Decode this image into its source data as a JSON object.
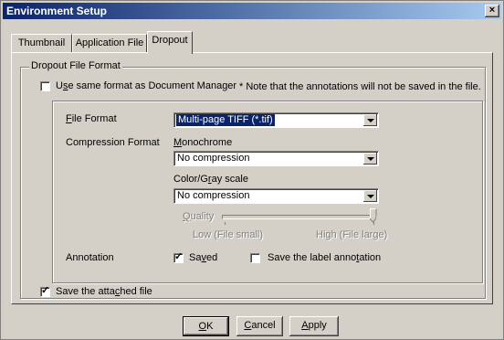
{
  "window": {
    "title": "Environment Setup",
    "close_glyph": "×"
  },
  "tabs": [
    {
      "label": "Thumbnail"
    },
    {
      "label": "Application File"
    },
    {
      "label": "Dropout"
    }
  ],
  "group": {
    "label": "Dropout File Format",
    "use_same_format": {
      "label_pre": "U",
      "label_u": "s",
      "label_post": "e same format as Document Manager",
      "checked": false
    },
    "note": "* Note that the annotations will not be saved in the file."
  },
  "file_format": {
    "label_u": "F",
    "label_post": "ile Format",
    "value": "Multi-page TIFF (*.tif)"
  },
  "compression": {
    "label": "Compression Format",
    "mono_label_u": "M",
    "mono_label_post": "onochrome",
    "mono_value": "No compression",
    "color_label_pre": "Color/G",
    "color_label_u": "r",
    "color_label_post": "ay scale",
    "color_value": "No compression"
  },
  "quality": {
    "label_u": "Q",
    "label_post": "uality",
    "low": "Low (File small)",
    "high": "High (File large)",
    "level": 1.0
  },
  "annotation": {
    "label": "Annotation",
    "saved": {
      "label_pre": "Sa",
      "label_u": "v",
      "label_post": "ed",
      "checked": true
    },
    "save_label": {
      "label_pre": "Save the label anno",
      "label_u": "t",
      "label_post": "ation",
      "checked": false
    }
  },
  "save_attached": {
    "label_pre": "Save the atta",
    "label_u": "c",
    "label_post": "hed file",
    "checked": true
  },
  "buttons": {
    "ok": {
      "u": "O",
      "rest": "K"
    },
    "cancel": {
      "u": "C",
      "rest": "ancel"
    },
    "apply": {
      "u": "A",
      "rest": "pply"
    }
  },
  "check_glyph": "✓"
}
